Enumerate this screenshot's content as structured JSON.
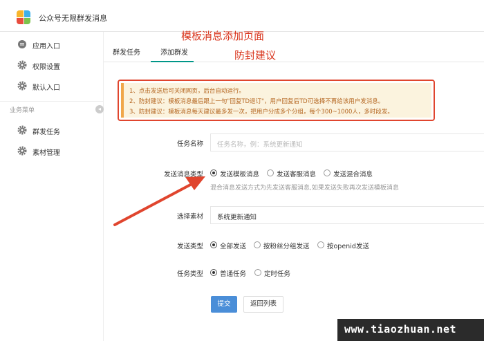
{
  "app": {
    "title": "公众号无限群发消息"
  },
  "sidebar": {
    "items_top": [
      {
        "label": "应用入口",
        "icon": "chat-icon"
      },
      {
        "label": "权限设置",
        "icon": "gear-icon"
      },
      {
        "label": "默认入口",
        "icon": "gear-icon"
      }
    ],
    "group_label": "业务菜单",
    "items_group": [
      {
        "label": "群发任务",
        "icon": "gear-icon"
      },
      {
        "label": "素材管理",
        "icon": "gear-icon"
      }
    ]
  },
  "tabs": [
    {
      "label": "群发任务"
    },
    {
      "label": "添加群发",
      "active": true
    }
  ],
  "annotations": {
    "title": "模板消息添加页面",
    "advice": "防封建议"
  },
  "notice": {
    "lines": [
      "1、点击发送后可关闭网页，后台自动运行。",
      "2、防封建议：模板消息最后跟上一句\"回复TD退订\"，用户回复后TD可选择不再给该用户发消息。",
      "3、防封建议：模板消息每天建议最多发一次，把用户分成多个分组，每个300~1000人，多时段发。"
    ]
  },
  "form": {
    "task_name": {
      "label": "任务名称",
      "placeholder": "任务名称，例：系统更新通知"
    },
    "msg_type": {
      "label": "发送消息类型",
      "options": [
        "发送模板消息",
        "发送客服消息",
        "发送混合消息"
      ],
      "selected": 0,
      "hint": "混合消息发送方式为先发送客服消息,如果发送失败再次发送模板消息"
    },
    "material": {
      "label": "选择素材",
      "value": "系统更新通知"
    },
    "send_type": {
      "label": "发送类型",
      "options": [
        "全部发送",
        "按粉丝分组发送",
        "按openid发送"
      ],
      "selected": 0
    },
    "task_type": {
      "label": "任务类型",
      "options": [
        "普通任务",
        "定时任务"
      ],
      "selected": 0
    },
    "submit": "提交",
    "back": "返回列表"
  },
  "watermark": "www.tiaozhuan.net",
  "colors": {
    "accent": "#009688",
    "primary_button": "#4a8ed8",
    "annotation": "#d9361e",
    "notice_text": "#b4651f"
  }
}
